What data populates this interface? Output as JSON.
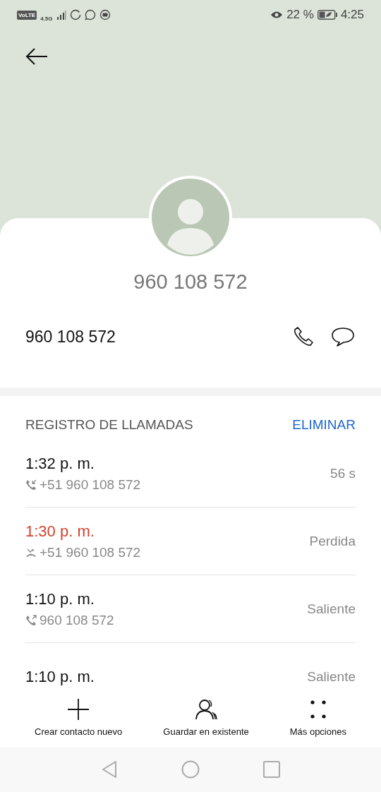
{
  "status_bar": {
    "network_badge": "VoLTE",
    "network_type": "4.5G",
    "battery": "22 %",
    "time": "4:25"
  },
  "contact": {
    "title": "960 108 572",
    "number": "960 108 572"
  },
  "call_log": {
    "title": "REGISTRO DE LLAMADAS",
    "action": "ELIMINAR",
    "calls": [
      {
        "kind": "incoming",
        "time": "1:32 p. m.",
        "number": "+51 960 108 572",
        "detail": "56 s"
      },
      {
        "kind": "missed",
        "time": "1:30 p. m.",
        "number": "+51 960 108 572",
        "detail": "Perdida"
      },
      {
        "kind": "outgoing",
        "time": "1:10 p. m.",
        "number": "960 108 572",
        "detail": "Saliente"
      },
      {
        "kind": "outgoing",
        "time": "1:10 p. m.",
        "detail": "Saliente"
      }
    ]
  },
  "actions": [
    {
      "kind": "add",
      "label": "Crear contacto nuevo"
    },
    {
      "kind": "person",
      "label": "Guardar en existente"
    },
    {
      "kind": "more",
      "label": "Más opciones"
    }
  ]
}
